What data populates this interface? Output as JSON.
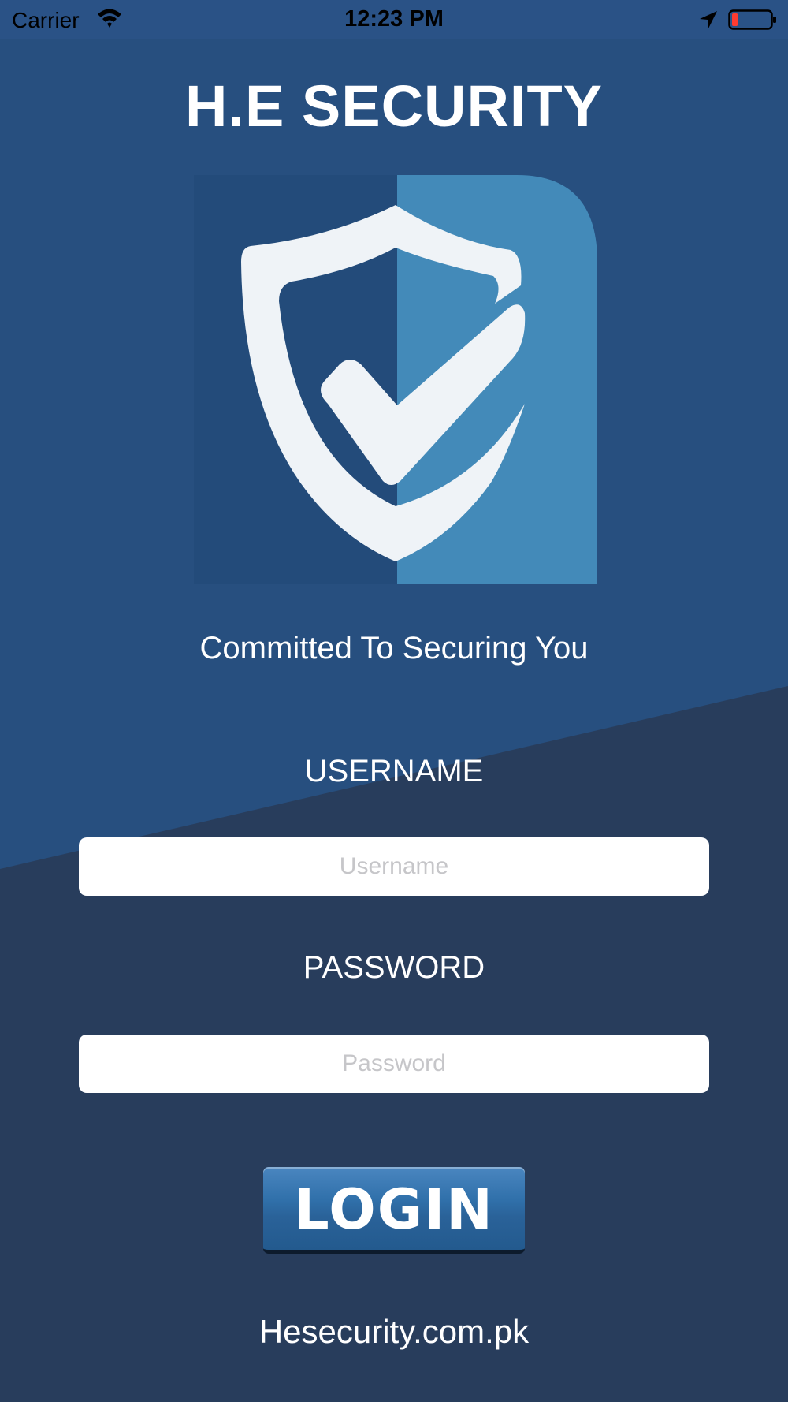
{
  "status_bar": {
    "carrier": "Carrier",
    "time": "12:23 PM",
    "battery_level": 0.15
  },
  "app": {
    "title": "H.E SECURITY",
    "tagline": "Committed To Securing You"
  },
  "form": {
    "username_label": "USERNAME",
    "username_placeholder": "Username",
    "username_value": "",
    "password_label": "PASSWORD",
    "password_placeholder": "Password",
    "password_value": "",
    "login_label": "LOGIN"
  },
  "footer": {
    "website": "Hesecurity.com.pk"
  },
  "colors": {
    "background_top": "#274f7f",
    "background_bottom": "#283d5c",
    "logo_dark": "#234b7a",
    "logo_light": "#438ab9",
    "shield": "#eff3f7",
    "button": "#2d6aa4"
  },
  "icons": {
    "logo": "shield-check-icon",
    "wifi": "wifi-icon",
    "location": "location-arrow-icon",
    "battery": "battery-icon"
  }
}
